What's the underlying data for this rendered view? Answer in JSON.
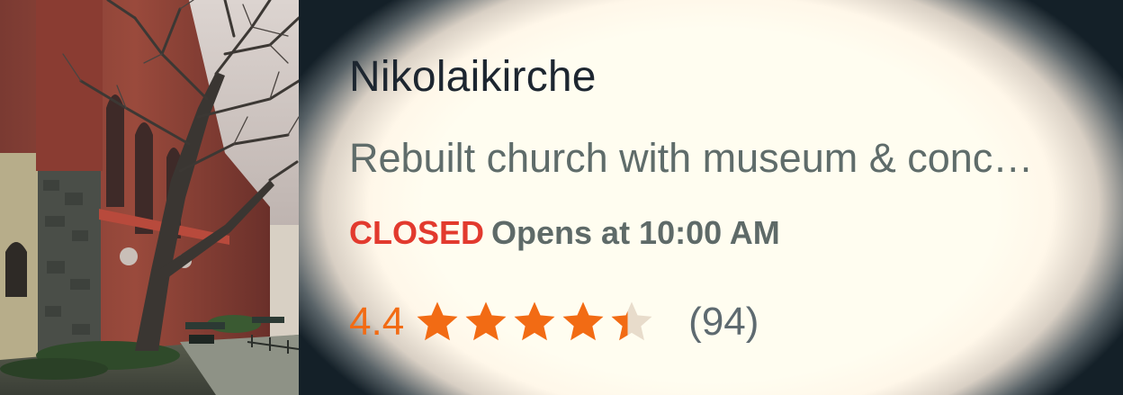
{
  "place": {
    "name": "Nikolaikirche",
    "description": "Rebuilt church with museum & conc…",
    "status": "CLOSED",
    "hours_text": "Opens at 10:00 AM",
    "rating": "4.4",
    "rating_value": 4.4,
    "rating_max": 5,
    "review_count": "(94)"
  },
  "colors": {
    "status_closed": "#e23a2e",
    "star_filled": "#f26b14",
    "star_empty": "#e8dccb",
    "title": "#1d2630",
    "secondary_text": "#5f6c6a"
  },
  "icons": {
    "star": "star-icon",
    "half_star": "star-half-icon"
  }
}
